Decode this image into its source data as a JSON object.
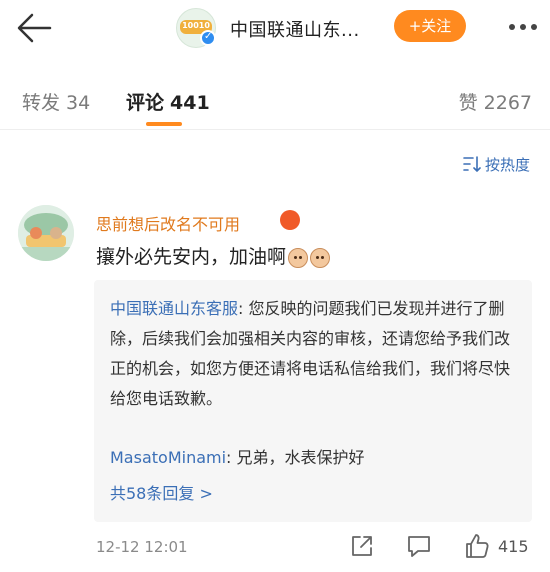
{
  "header": {
    "account_name": "中国联通山东...",
    "avatar_text": "10010",
    "follow_label": "+关注"
  },
  "tabs": [
    {
      "label": "转发",
      "count": "34"
    },
    {
      "label": "评论",
      "count": "441"
    },
    {
      "label": "赞",
      "count": "2267"
    }
  ],
  "sort": {
    "label": "按热度"
  },
  "comment": {
    "author": "思前想后改名不可用",
    "text": "攘外必先安内，加油啊",
    "time": "12-12 12:01",
    "likes": "415"
  },
  "replies": [
    {
      "author": "中国联通山东客服",
      "text": ": 您反映的问题我们已发现并进行了删除，后续我们会加强相关内容的审核，还请您给予我们改正的机会，如您方便还请将电话私信给我们，我们将尽快给您电话致歉。"
    },
    {
      "author": "MasatoMinami",
      "text": ": 兄弟，水表保护好"
    }
  ],
  "more_replies_label": "共58条回复 >",
  "colors": {
    "accent": "#ff8a1f",
    "link": "#3b6fb6",
    "username": "#e07a1e"
  }
}
